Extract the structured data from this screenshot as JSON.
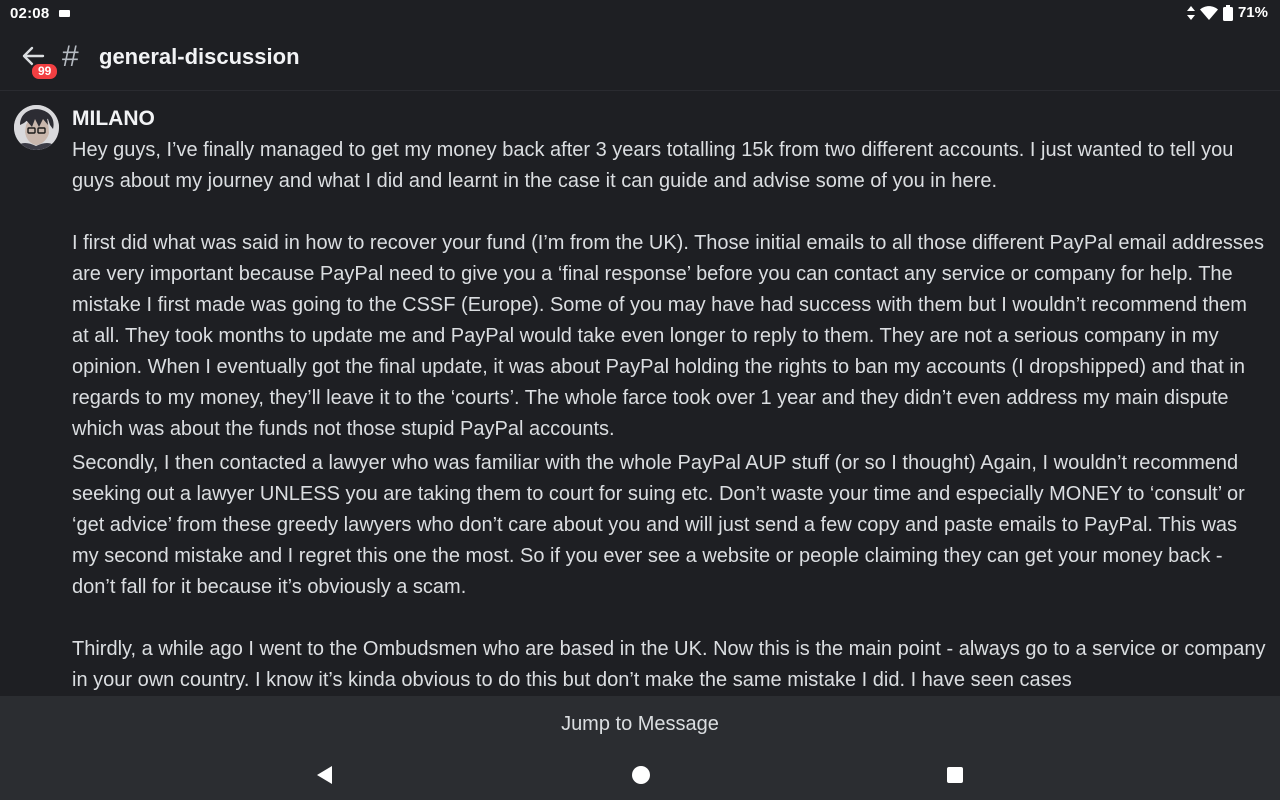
{
  "status": {
    "time": "02:08",
    "battery": "71%"
  },
  "header": {
    "badge": "99",
    "hash": "#",
    "channel": "general-discussion"
  },
  "message": {
    "author": "MILANO",
    "paragraphs": [
      "Hey guys, I’ve finally managed to get my money back after 3 years totalling 15k from two different accounts. I just wanted to tell you guys about my journey and what I did and learnt in the case it can guide and advise some of you in here.",
      "I first did what was said in how to recover your fund (I’m from the UK). Those initial emails to all those different PayPal email addresses are very important because PayPal need to give you a ‘final response’ before you can contact any service or company for help.  The mistake I first made was going to the CSSF (Europe). Some of you may have had success with them but I wouldn’t recommend them at all. They took months to update me and PayPal would take even longer to reply to them. They are not a serious company in my opinion. When I eventually got the final update, it was about PayPal holding the rights to ban my accounts (I dropshipped) and that in regards to my money, they’ll leave it to the ‘courts’. The whole farce took over 1 year and they didn’t even address my main dispute which was about the funds not those stupid PayPal accounts.",
      "Secondly, I then contacted a lawyer who was familiar with the whole PayPal AUP stuff (or so I thought) Again, I wouldn’t recommend seeking out a lawyer UNLESS you are taking them to court for suing etc. Don’t waste your time and especially MONEY to ‘consult’ or ‘get advice’ from these greedy lawyers who don’t care about you and will just send a few copy and paste emails to PayPal. This was my second mistake and I regret this one the most. So if you ever see a website or people claiming they can get your money back - don’t fall for it because it’s obviously a scam.",
      "Thirdly, a while ago I went to the Ombudsmen who are based in the UK. Now this is the main point - always go to a service or company in your own country. I know it’s kinda obvious to do this but don’t make the same mistake I did. I have seen cases"
    ]
  },
  "jump": {
    "label": "Jump to Message"
  },
  "colors": {
    "background": "#1e1f23",
    "bar": "#2b2d31",
    "badge": "#f23f42",
    "text": "#dbdee1"
  }
}
